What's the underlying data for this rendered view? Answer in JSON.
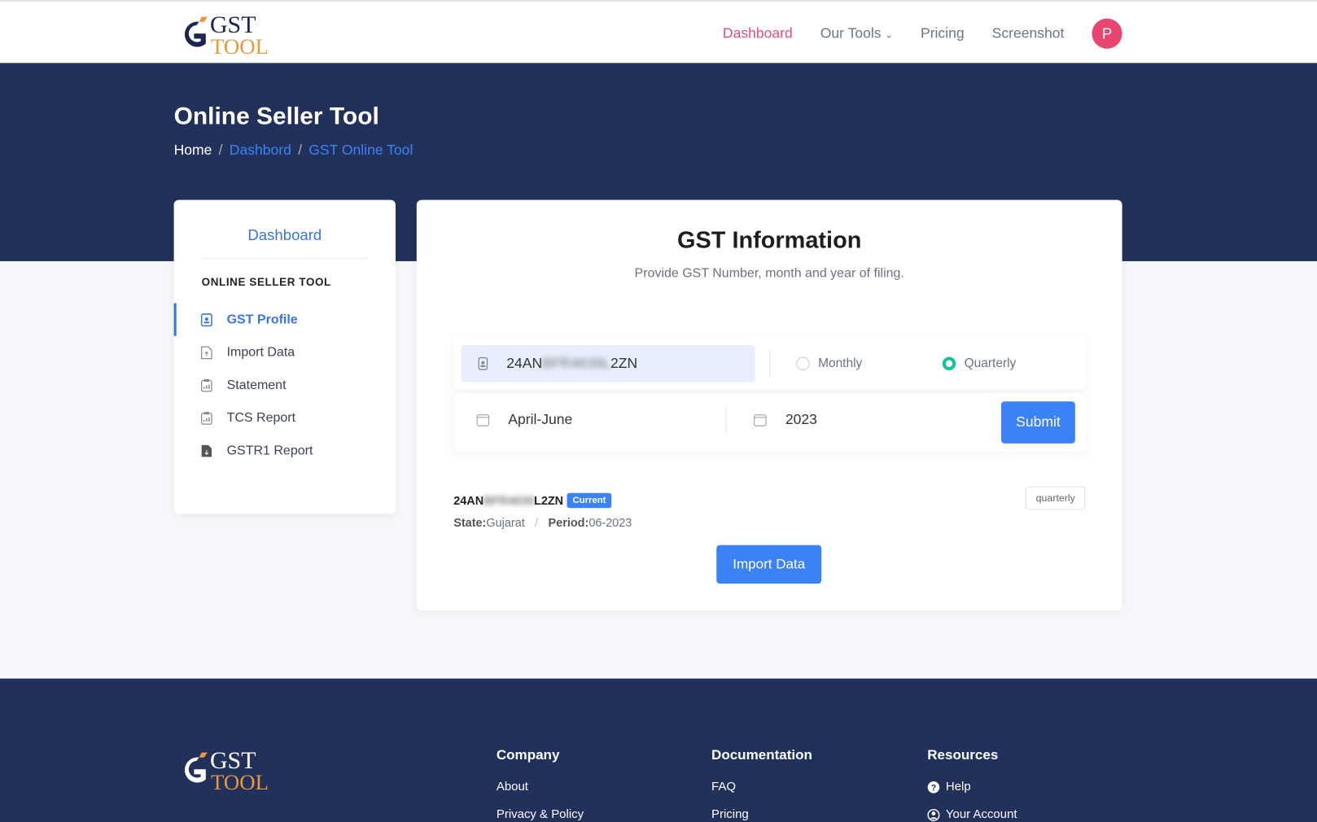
{
  "brand": {
    "logo_text_top": "GST",
    "logo_text_bottom": "TOOL",
    "colors": {
      "navy": "#22315b",
      "orange": "#e8983a",
      "accent": "#3b82f6",
      "pink": "#e84671",
      "teal": "#16c0a0"
    }
  },
  "nav": {
    "items": [
      "Dashboard",
      "Our Tools",
      "Pricing",
      "Screenshot"
    ],
    "active": "Dashboard",
    "avatar": "P"
  },
  "hero": {
    "title": "Online Seller Tool",
    "breadcrumb": [
      "Home",
      "Dashbord",
      "GST Online Tool"
    ]
  },
  "sidebar": {
    "title": "Dashboard",
    "section": "ONLINE SELLER TOOL",
    "items": [
      {
        "label": "GST Profile",
        "icon": "id-badge-icon",
        "active": true
      },
      {
        "label": "Import Data",
        "icon": "file-upload-icon"
      },
      {
        "label": "Statement",
        "icon": "clipboard-chart-icon"
      },
      {
        "label": "TCS Report",
        "icon": "clipboard-chart-icon"
      },
      {
        "label": "GSTR1 Report",
        "icon": "file-download-icon"
      }
    ]
  },
  "main": {
    "title": "GST Information",
    "subtitle": "Provide GST Number, month and year of filing.",
    "gstin_prefix": "24AN",
    "gstin_masked": "BFR4639L",
    "gstin_suffix": "2ZN",
    "frequency_options": [
      "Monthly",
      "Quarterly"
    ],
    "frequency_selected": "Quarterly",
    "period": "April-June",
    "year": "2023",
    "submit_label": "Submit",
    "result": {
      "gstin_prefix": "24AN",
      "gstin_masked": "BFR4639",
      "gstin_suffix": "L2ZN",
      "badge": "Current",
      "state_label": "State:",
      "state": "Gujarat",
      "period_label": "Period:",
      "period": "06-2023",
      "frequency": "quarterly"
    },
    "import_label": "Import Data"
  },
  "footer": {
    "columns": [
      {
        "title": "Company",
        "links": [
          "About",
          "Privacy & Policy"
        ]
      },
      {
        "title": "Documentation",
        "links": [
          "FAQ",
          "Pricing"
        ]
      },
      {
        "title": "Resources",
        "links": [
          "Help",
          "Your Account"
        ]
      }
    ]
  }
}
